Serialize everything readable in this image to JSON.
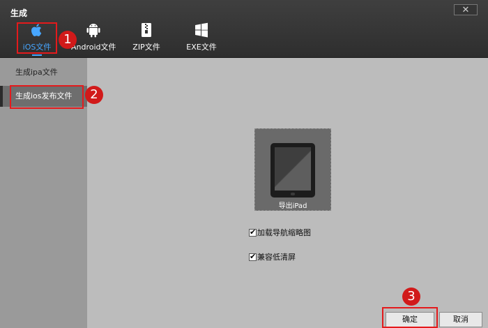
{
  "window": {
    "title": "生成",
    "close_icon": "close-icon"
  },
  "tabs": [
    {
      "label": "iOS文件",
      "icon": "apple-icon",
      "active": true
    },
    {
      "label": "Android文件",
      "icon": "android-icon",
      "active": false
    },
    {
      "label": "ZIP文件",
      "icon": "zip-icon",
      "active": false
    },
    {
      "label": "EXE文件",
      "icon": "windows-icon",
      "active": false
    }
  ],
  "sidebar": {
    "items": [
      {
        "label": "生成ipa文件",
        "active": false
      },
      {
        "label": "生成ios发布文件",
        "active": true
      }
    ]
  },
  "preview": {
    "label": "导出iPad",
    "icon": "ipad-icon"
  },
  "options": [
    {
      "label": "加载导航缩略图",
      "checked": true
    },
    {
      "label": "兼容低清屏",
      "checked": true
    }
  ],
  "buttons": {
    "ok": "确定",
    "cancel": "取消"
  },
  "annotations": [
    {
      "number": "1"
    },
    {
      "number": "2"
    },
    {
      "number": "3"
    }
  ],
  "colors": {
    "accent": "#47a6ff",
    "highlight": "#e41a1c",
    "marker": "#d11a1a"
  }
}
